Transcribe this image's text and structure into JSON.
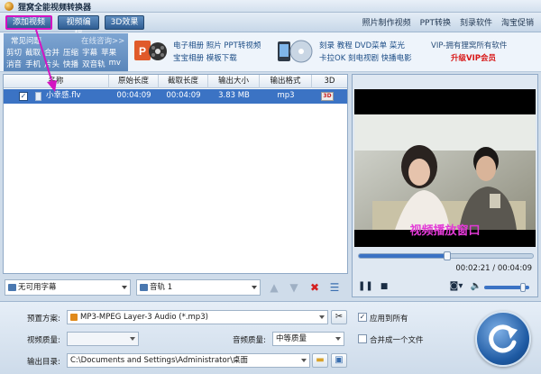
{
  "window": {
    "title": "狸窝全能视频转换器"
  },
  "toolbar": {
    "add_video": "添加视频",
    "video_edit": "视频编辑",
    "effects_3d": "3D效果",
    "links": [
      "照片制作视频",
      "PPT转换",
      "刻录软件",
      "淘宝促销"
    ]
  },
  "banner": {
    "faq_title": "常见问题",
    "faq_consult": "在线咨询>>",
    "faq_row1": [
      "剪切",
      "截取",
      "合并",
      "压缩",
      "字幕",
      "苹果"
    ],
    "faq_row2": [
      "消音",
      "手机",
      "片头",
      "快播",
      "双音轨",
      "mv"
    ],
    "promo1_line1": "电子相册  照片  PPT转视频",
    "promo1_line2": "宝宝相册  模板下载",
    "promo2_line1": "刻录  教程  DVD菜单  菜光",
    "promo2_line2": "卡拉OK  刻电视剧  快播电影",
    "vip_line": "VIP-拥有狸窝所有软件",
    "vip_sub": "升级VIP会员"
  },
  "filelist": {
    "columns": [
      "名称",
      "原始长度",
      "截取长度",
      "输出大小",
      "输出格式",
      "3D"
    ],
    "rows": [
      {
        "checked": "✓",
        "name": "小幸感.flv",
        "original_length": "00:04:09",
        "clip_length": "00:04:09",
        "output_size": "3.83 MB",
        "output_format": "mp3",
        "three_d": "3D"
      }
    ]
  },
  "listbar": {
    "subtitle": "无可用字幕",
    "audio_track": "音轨 1"
  },
  "preview": {
    "label": "视频播放窗口",
    "progress": 0.51,
    "timecode": "00:02:21 / 00:04:09",
    "volume": 0.85
  },
  "settings": {
    "preset_label": "预置方案:",
    "preset_value": "MP3-MPEG Layer-3 Audio (*.mp3)",
    "apply_all": "应用到所有",
    "apply_all_checked": "✓",
    "video_quality_label": "视频质量:",
    "video_quality_value": "",
    "audio_quality_label": "音频质量:",
    "audio_quality_value": "中等质量",
    "merge_label": "合并成一个文件",
    "output_label": "输出目录:",
    "output_value": "C:\\Documents and Settings\\Administrator\\桌面"
  },
  "colors": {
    "accent": "#3b73c4",
    "highlight": "#d414c2",
    "vip_red": "#d81818"
  }
}
